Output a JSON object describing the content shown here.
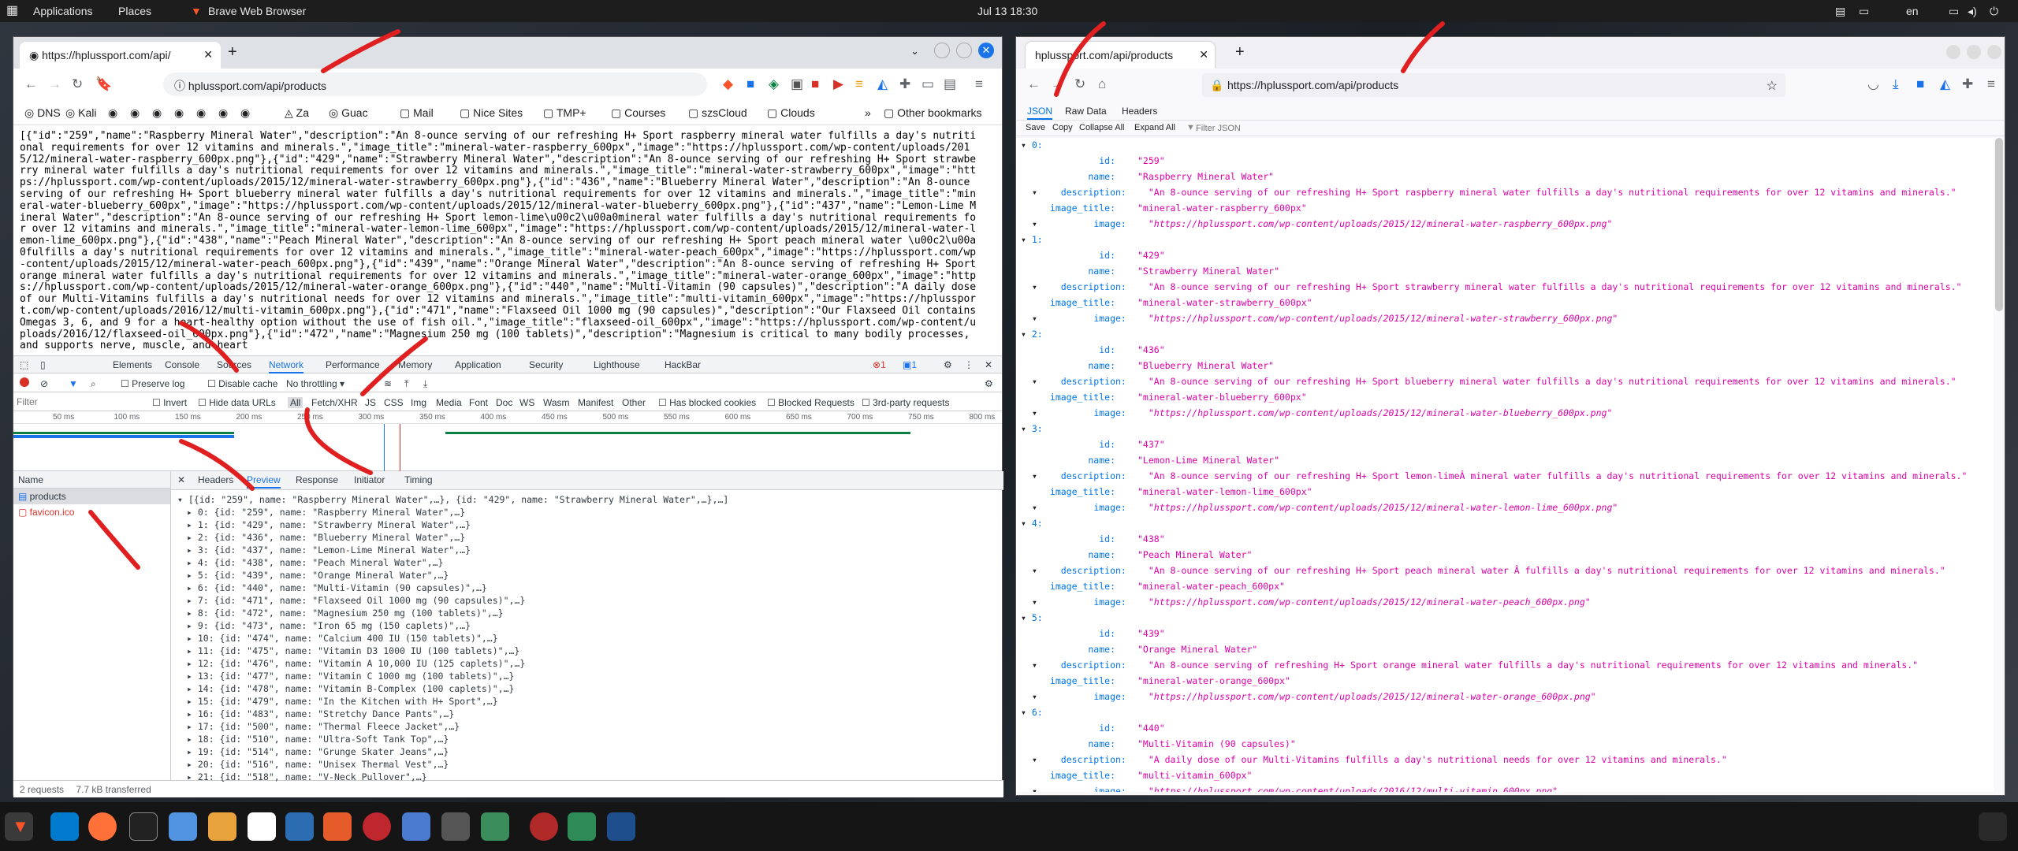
{
  "topbar": {
    "applications": "Applications",
    "places": "Places",
    "app_name": "Brave Web Browser",
    "clock": "Jul 13 18:30",
    "lang": "en"
  },
  "left_browser": {
    "tab_title": "https://hplussport.com/api/",
    "url": "hplussport.com/api/products",
    "bookmarks": [
      "DNS",
      "Kali",
      "Za",
      "Guac",
      "Mail",
      "Nice Sites",
      "TMP+",
      "Courses",
      "szsCloud",
      "Clouds"
    ],
    "other_bookmarks": "Other bookmarks",
    "raw_json": "[{\"id\":\"259\",\"name\":\"Raspberry Mineral Water\",\"description\":\"An 8-ounce serving of our refreshing H+ Sport raspberry mineral water fulfills a day's nutritional requirements for over 12 vitamins and minerals.\",\"image_title\":\"mineral-water-raspberry_600px\",\"image\":\"https://hplussport.com/wp-content/uploads/2015/12/mineral-water-raspberry_600px.png\"},{\"id\":\"429\",\"name\":\"Strawberry Mineral Water\",\"description\":\"An 8-ounce serving of our refreshing H+ Sport strawberry mineral water fulfills a day's nutritional requirements for over 12 vitamins and minerals.\",\"image_title\":\"mineral-water-strawberry_600px\",\"image\":\"https://hplussport.com/wp-content/uploads/2015/12/mineral-water-strawberry_600px.png\"},{\"id\":\"436\",\"name\":\"Blueberry Mineral Water\",\"description\":\"An 8-ounce serving of our refreshing H+ Sport blueberry mineral water fulfills a day's nutritional requirements for over 12 vitamins and minerals.\",\"image_title\":\"mineral-water-blueberry_600px\",\"image\":\"https://hplussport.com/wp-content/uploads/2015/12/mineral-water-blueberry_600px.png\"},{\"id\":\"437\",\"name\":\"Lemon-Lime Mineral Water\",\"description\":\"An 8-ounce serving of our refreshing H+ Sport lemon-lime\\u00c2\\u00a0mineral water fulfills a day's nutritional requirements for over 12 vitamins and minerals.\",\"image_title\":\"mineral-water-lemon-lime_600px\",\"image\":\"https://hplussport.com/wp-content/uploads/2015/12/mineral-water-lemon-lime_600px.png\"},{\"id\":\"438\",\"name\":\"Peach Mineral Water\",\"description\":\"An 8-ounce serving of our refreshing H+ Sport peach mineral water \\u00c2\\u00a0fulfills a day's nutritional requirements for over 12 vitamins and minerals.\",\"image_title\":\"mineral-water-peach_600px\",\"image\":\"https://hplussport.com/wp-content/uploads/2015/12/mineral-water-peach_600px.png\"},{\"id\":\"439\",\"name\":\"Orange Mineral Water\",\"description\":\"An 8-ounce serving of refreshing H+ Sport orange mineral water fulfills a day's nutritional requirements for over 12 vitamins and minerals.\",\"image_title\":\"mineral-water-orange_600px\",\"image\":\"https://hplussport.com/wp-content/uploads/2015/12/mineral-water-orange_600px.png\"},{\"id\":\"440\",\"name\":\"Multi-Vitamin (90 capsules)\",\"description\":\"A daily dose of our Multi-Vitamins fulfills a day's nutritional needs for over 12 vitamins and minerals.\",\"image_title\":\"multi-vitamin_600px\",\"image\":\"https://hplussport.com/wp-content/uploads/2016/12/multi-vitamin_600px.png\"},{\"id\":\"471\",\"name\":\"Flaxseed Oil 1000 mg (90 capsules)\",\"description\":\"Our Flaxseed Oil contains Omegas 3, 6, and 9 for a heart-healthy option without the use of fish oil.\",\"image_title\":\"flaxseed-oil_600px\",\"image\":\"https://hplussport.com/wp-content/uploads/2016/12/flaxseed-oil_600px.png\"},{\"id\":\"472\",\"name\":\"Magnesium 250 mg (100 tablets)\",\"description\":\"Magnesium is critical to many bodily processes, and supports nerve, muscle, and heart",
    "devtools": {
      "tabs": [
        "Elements",
        "Console",
        "Sources",
        "Network",
        "Performance",
        "Memory",
        "Application",
        "Security",
        "Lighthouse",
        "HackBar"
      ],
      "active_tab": "Network",
      "errors": "1",
      "messages": "1",
      "preserve_log": "Preserve log",
      "disable_cache": "Disable cache",
      "throttling": "No throttling",
      "filter_placeholder": "Filter",
      "invert": "Invert",
      "hide_data_urls": "Hide data URLs",
      "types": [
        "All",
        "Fetch/XHR",
        "JS",
        "CSS",
        "Img",
        "Media",
        "Font",
        "Doc",
        "WS",
        "Wasm",
        "Manifest",
        "Other"
      ],
      "has_blocked_cookies": "Has blocked cookies",
      "blocked_requests": "Blocked Requests",
      "third_party": "3rd-party requests",
      "ticks": [
        "50 ms",
        "100 ms",
        "150 ms",
        "200 ms",
        "250 ms",
        "300 ms",
        "350 ms",
        "400 ms",
        "450 ms",
        "500 ms",
        "550 ms",
        "600 ms",
        "650 ms",
        "700 ms",
        "750 ms",
        "800 ms"
      ],
      "name_header": "Name",
      "requests": [
        "products",
        "favicon.ico"
      ],
      "detail_tabs": [
        "Headers",
        "Preview",
        "Response",
        "Initiator",
        "Timing"
      ],
      "preview_head": "[{id: \"259\", name: \"Raspberry Mineral Water\",…}, {id: \"429\", name: \"Strawberry Mineral Water\",…},…]",
      "preview_rows": [
        "0: {id: \"259\", name: \"Raspberry Mineral Water\",…}",
        "1: {id: \"429\", name: \"Strawberry Mineral Water\",…}",
        "2: {id: \"436\", name: \"Blueberry Mineral Water\",…}",
        "3: {id: \"437\", name: \"Lemon-Lime Mineral Water\",…}",
        "4: {id: \"438\", name: \"Peach Mineral Water\",…}",
        "5: {id: \"439\", name: \"Orange Mineral Water\",…}",
        "6: {id: \"440\", name: \"Multi-Vitamin (90 capsules)\",…}",
        "7: {id: \"471\", name: \"Flaxseed Oil 1000 mg (90 capsules)\",…}",
        "8: {id: \"472\", name: \"Magnesium 250 mg (100 tablets)\",…}",
        "9: {id: \"473\", name: \"Iron 65 mg (150 caplets)\",…}",
        "10: {id: \"474\", name: \"Calcium 400 IU (150 tablets)\",…}",
        "11: {id: \"475\", name: \"Vitamin D3 1000 IU (100 tablets)\",…}",
        "12: {id: \"476\", name: \"Vitamin A 10,000 IU (125 caplets)\",…}",
        "13: {id: \"477\", name: \"Vitamin C 1000 mg (100 tablets)\",…}",
        "14: {id: \"478\", name: \"Vitamin B-Complex (100 caplets)\",…}",
        "15: {id: \"479\", name: \"In the Kitchen with H+ Sport\",…}",
        "16: {id: \"483\", name: \"Stretchy Dance Pants\",…}",
        "17: {id: \"500\", name: \"Thermal Fleece Jacket\",…}",
        "18: {id: \"510\", name: \"Ultra-Soft Tank Top\",…}",
        "19: {id: \"514\", name: \"Grunge Skater Jeans\",…}",
        "20: {id: \"516\", name: \"Unisex Thermal Vest\",…}",
        "21: {id: \"518\", name: \"V-Neck Pullover\",…}"
      ],
      "status_requests": "2 requests",
      "status_transferred": "7.7 kB transferred"
    }
  },
  "right_browser": {
    "tab_title": "hplussport.com/api/products",
    "url": "https://hplussport.com/api/products",
    "viewer_tabs": [
      "JSON",
      "Raw Data",
      "Headers"
    ],
    "tools": [
      "Save",
      "Copy",
      "Collapse All",
      "Expand All"
    ],
    "filter_placeholder": "Filter JSON",
    "items": [
      {
        "idx": "0:",
        "id": "\"259\"",
        "name": "\"Raspberry Mineral Water\"",
        "description": "\"An 8-ounce serving of our refreshing H+ Sport raspberry mineral water fulfills a day's nutritional requirements for over 12 vitamins and minerals.\"",
        "image_title": "\"mineral-water-raspberry_600px\"",
        "image": "\"https://hplussport.com/wp-content/uploads/2015/12/mineral-water-raspberry_600px.png\""
      },
      {
        "idx": "1:",
        "id": "\"429\"",
        "name": "\"Strawberry Mineral Water\"",
        "description": "\"An 8-ounce serving of our refreshing H+ Sport strawberry mineral water fulfills a day's nutritional requirements for over 12 vitamins and minerals.\"",
        "image_title": "\"mineral-water-strawberry_600px\"",
        "image": "\"https://hplussport.com/wp-content/uploads/2015/12/mineral-water-strawberry_600px.png\""
      },
      {
        "idx": "2:",
        "id": "\"436\"",
        "name": "\"Blueberry Mineral Water\"",
        "description": "\"An 8-ounce serving of our refreshing H+ Sport blueberry mineral water fulfills a day's nutritional requirements for over 12 vitamins and minerals.\"",
        "image_title": "\"mineral-water-blueberry_600px\"",
        "image": "\"https://hplussport.com/wp-content/uploads/2015/12/mineral-water-blueberry_600px.png\""
      },
      {
        "idx": "3:",
        "id": "\"437\"",
        "name": "\"Lemon-Lime Mineral Water\"",
        "description": "\"An 8-ounce serving of our refreshing H+ Sport lemon-limeÂ mineral water fulfills a day's nutritional requirements for over 12 vitamins and minerals.\"",
        "image_title": "\"mineral-water-lemon-lime_600px\"",
        "image": "\"https://hplussport.com/wp-content/uploads/2015/12/mineral-water-lemon-lime_600px.png\""
      },
      {
        "idx": "4:",
        "id": "\"438\"",
        "name": "\"Peach Mineral Water\"",
        "description": "\"An 8-ounce serving of our refreshing H+ Sport peach mineral water Â fulfills a day's nutritional requirements for over 12 vitamins and minerals.\"",
        "image_title": "\"mineral-water-peach_600px\"",
        "image": "\"https://hplussport.com/wp-content/uploads/2015/12/mineral-water-peach_600px.png\""
      },
      {
        "idx": "5:",
        "id": "\"439\"",
        "name": "\"Orange Mineral Water\"",
        "description": "\"An 8-ounce serving of refreshing H+ Sport orange mineral water fulfills a day's nutritional requirements for over 12 vitamins and minerals.\"",
        "image_title": "\"mineral-water-orange_600px\"",
        "image": "\"https://hplussport.com/wp-content/uploads/2015/12/mineral-water-orange_600px.png\""
      },
      {
        "idx": "6:",
        "id": "\"440\"",
        "name": "\"Multi-Vitamin (90 capsules)\"",
        "description": "\"A daily dose of our Multi-Vitamins fulfills a day's nutritional needs for over 12 vitamins and minerals.\"",
        "image_title": "\"multi-vitamin_600px\"",
        "image": "\"https://hplussport.com/wp-content/uploads/2016/12/multi-vitamin_600px.png\""
      }
    ],
    "keys": {
      "id": "id:",
      "name": "name:",
      "description": "description:",
      "image_title": "image_title:",
      "image": "image:"
    }
  },
  "colors": {
    "annotation_arrow": "#e02020",
    "brave_orange": "#fb542b",
    "json_key": "#0074e8",
    "json_string": "#dd00a9"
  }
}
